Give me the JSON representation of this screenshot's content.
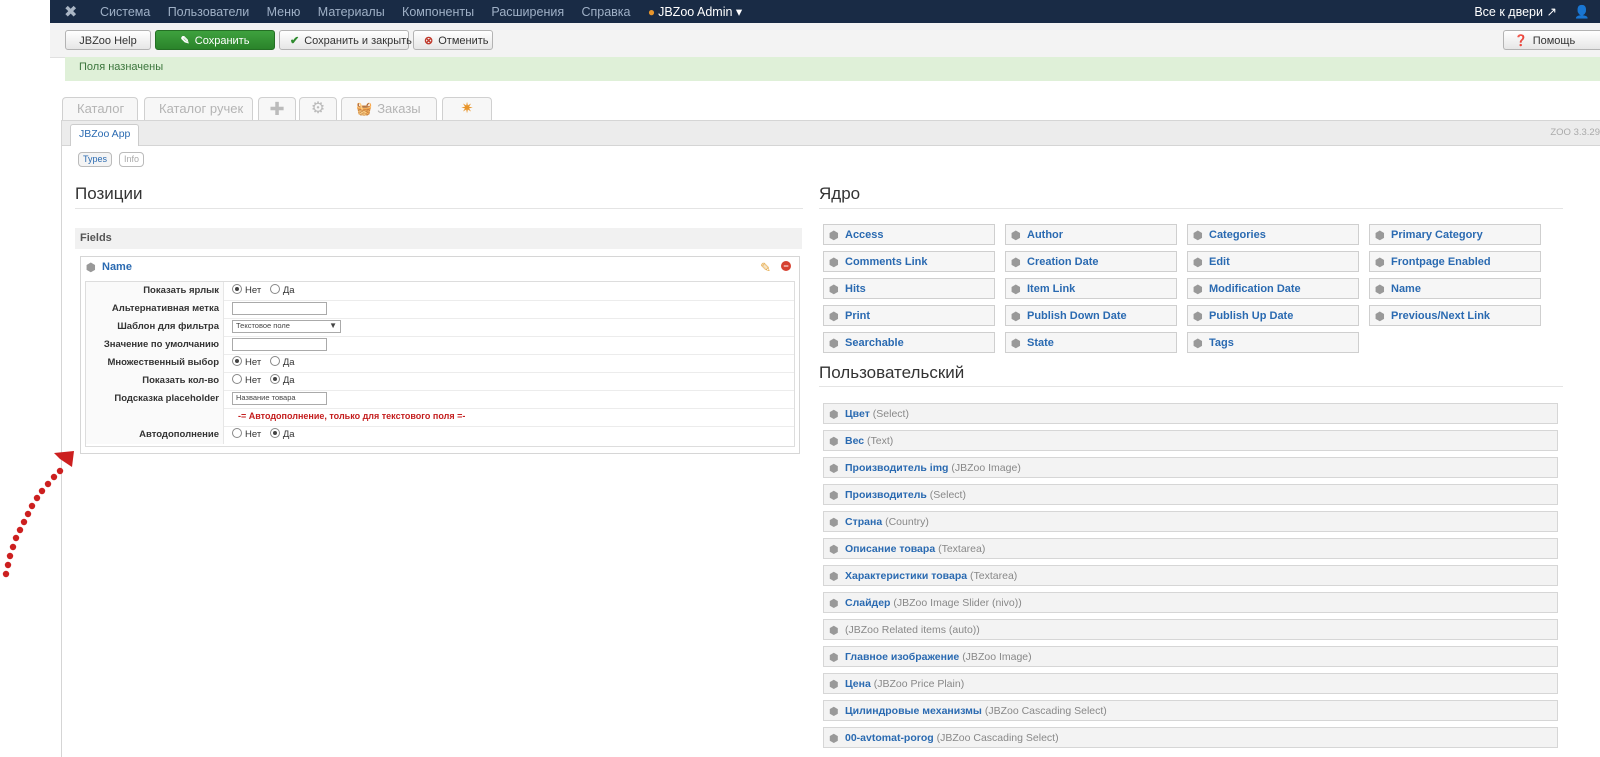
{
  "navbar": {
    "menu": [
      "Система",
      "Пользователи",
      "Меню",
      "Материалы",
      "Компоненты",
      "Расширения",
      "Справка"
    ],
    "admin_label": "JBZoo Admin",
    "site_link": "Все к двери",
    "logo_icon": "joomla-icon",
    "user_icon": "user-icon"
  },
  "toolbar": {
    "help_label": "JBZoo Help",
    "save_label": "Сохранить",
    "save_close_label": "Сохранить и закрыть",
    "cancel_label": "Отменить",
    "help_right_label": "Помощь"
  },
  "message": "Поля назначены",
  "tabs": [
    "Каталог",
    "Каталог ручек",
    "Заказы"
  ],
  "subtab": "JBZoo App",
  "version": "ZOO 3.3.29",
  "pills": {
    "types": "Types",
    "info": "Info"
  },
  "left": {
    "title": "Позиции",
    "fields_header": "Fields",
    "field_name": "Name",
    "params": [
      {
        "label": "Показать ярлык"
      },
      {
        "label": "Альтернативная метка"
      },
      {
        "label": "Шаблон для фильтра"
      },
      {
        "label": "Значение по умолчанию"
      },
      {
        "label": "Множественный выбор"
      },
      {
        "label": "Показать кол-во"
      },
      {
        "label": "Подсказка placeholder"
      },
      {
        "label": ""
      },
      {
        "label": "Автодополнение"
      }
    ],
    "radio_no": "Нет",
    "radio_yes": "Да",
    "filter_template": "Текстовое поле",
    "placeholder_value": "Название товара",
    "warning": "-= Автодополнение, только для текстового поля =-"
  },
  "right": {
    "core_title": "Ядро",
    "core_fields": [
      "Access",
      "Author",
      "Categories",
      "Primary Category",
      "Comments Link",
      "Creation Date",
      "Edit",
      "Frontpage Enabled",
      "Hits",
      "Item Link",
      "Modification Date",
      "Name",
      "Print",
      "Publish Down Date",
      "Publish Up Date",
      "Previous/Next Link",
      "Searchable",
      "State",
      "Tags"
    ],
    "custom_title": "Пользовательский",
    "custom_fields": [
      {
        "name": "Цвет",
        "type": "(Select)"
      },
      {
        "name": "Вес",
        "type": "(Text)"
      },
      {
        "name": "Производитель img",
        "type": "(JBZoo Image)"
      },
      {
        "name": "Производитель",
        "type": "(Select)"
      },
      {
        "name": "Страна",
        "type": "(Country)"
      },
      {
        "name": "Описание товара",
        "type": "(Textarea)"
      },
      {
        "name": "Характеристики товара",
        "type": "(Textarea)"
      },
      {
        "name": "Слайдер",
        "type": "(JBZoo Image Slider (nivo))"
      },
      {
        "name": "",
        "type": "(JBZoo Related items (auto))"
      },
      {
        "name": "Главное изображение",
        "type": "(JBZoo Image)"
      },
      {
        "name": "Цена",
        "type": "(JBZoo Price Plain)"
      },
      {
        "name": "Цилиндровые механизмы",
        "type": "(JBZoo Cascading Select)"
      },
      {
        "name": "00-avtomat-porog",
        "type": "(JBZoo Cascading Select)"
      }
    ]
  },
  "colors": {
    "navbar": "#192b45",
    "link": "#2a6ab1",
    "success_bg": "#dff0d8",
    "save_green": "#2e8b2e",
    "warning": "#c41e1e"
  }
}
